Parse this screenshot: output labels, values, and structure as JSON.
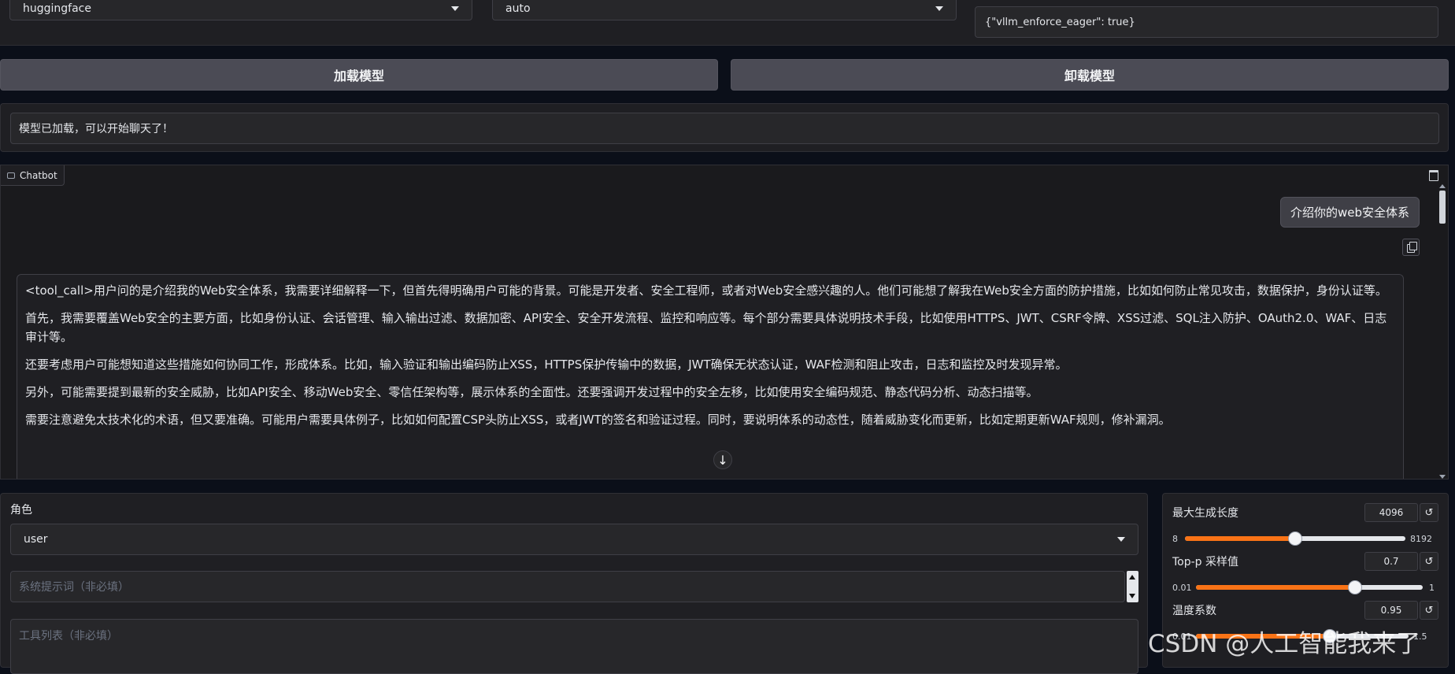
{
  "top": {
    "model_source": "huggingface",
    "dtype": "auto",
    "infer_args": "{\"vllm_enforce_eager\": true}"
  },
  "buttons": {
    "load": "加载模型",
    "unload": "卸载模型"
  },
  "status": "模型已加载，可以开始聊天了！",
  "chatbot": {
    "label": "Chatbot",
    "user_message": "介绍你的web安全体系",
    "bot_paragraphs": [
      "<tool_call>用户问的是介绍我的Web安全体系，我需要详细解释一下，但首先得明确用户可能的背景。可能是开发者、安全工程师，或者对Web安全感兴趣的人。他们可能想了解我在Web安全方面的防护措施，比如如何防止常见攻击，数据保护，身份认证等。",
      "首先，我需要覆盖Web安全的主要方面，比如身份认证、会话管理、输入输出过滤、数据加密、API安全、安全开发流程、监控和响应等。每个部分需要具体说明技术手段，比如使用HTTPS、JWT、CSRF令牌、XSS过滤、SQL注入防护、OAuth2.0、WAF、日志审计等。",
      "还要考虑用户可能想知道这些措施如何协同工作，形成体系。比如，输入验证和输出编码防止XSS，HTTPS保护传输中的数据，JWT确保无状态认证，WAF检测和阻止攻击，日志和监控及时发现异常。",
      "另外，可能需要提到最新的安全威胁，比如API安全、移动Web安全、零信任架构等，展示体系的全面性。还要强调开发过程中的安全左移，比如使用安全编码规范、静态代码分析、动态扫描等。",
      "需要注意避免太技术化的术语，但又要准确。可能用户需要具体例子，比如如何配置CSP头防止XSS，或者JWT的签名和验证过程。同时，要说明体系的动态性，随着威胁变化而更新，比如定期更新WAF规则，修补漏洞。"
    ],
    "scroll_down_glyph": "↓"
  },
  "input": {
    "role_label": "角色",
    "role_value": "user",
    "system_prompt_placeholder": "系统提示词（非必填）",
    "tools_placeholder": "工具列表（非必填）"
  },
  "params": {
    "max_length": {
      "label": "最大生成长度",
      "value": "4096",
      "min": "8",
      "max": "8192",
      "fraction": 0.5
    },
    "top_p": {
      "label": "Top-p 采样值",
      "value": "0.7",
      "min": "0.01",
      "max": "1",
      "fraction": 0.7
    },
    "temperature": {
      "label": "温度系数",
      "value": "0.95",
      "min": "0.01",
      "max": "1.5",
      "fraction": 0.63
    }
  },
  "reset_glyph": "↺",
  "watermark": "CSDN @人工智能我来了",
  "colors": {
    "accent": "#f97316",
    "background": "#0b0f19",
    "panel": "#1f1f23"
  }
}
